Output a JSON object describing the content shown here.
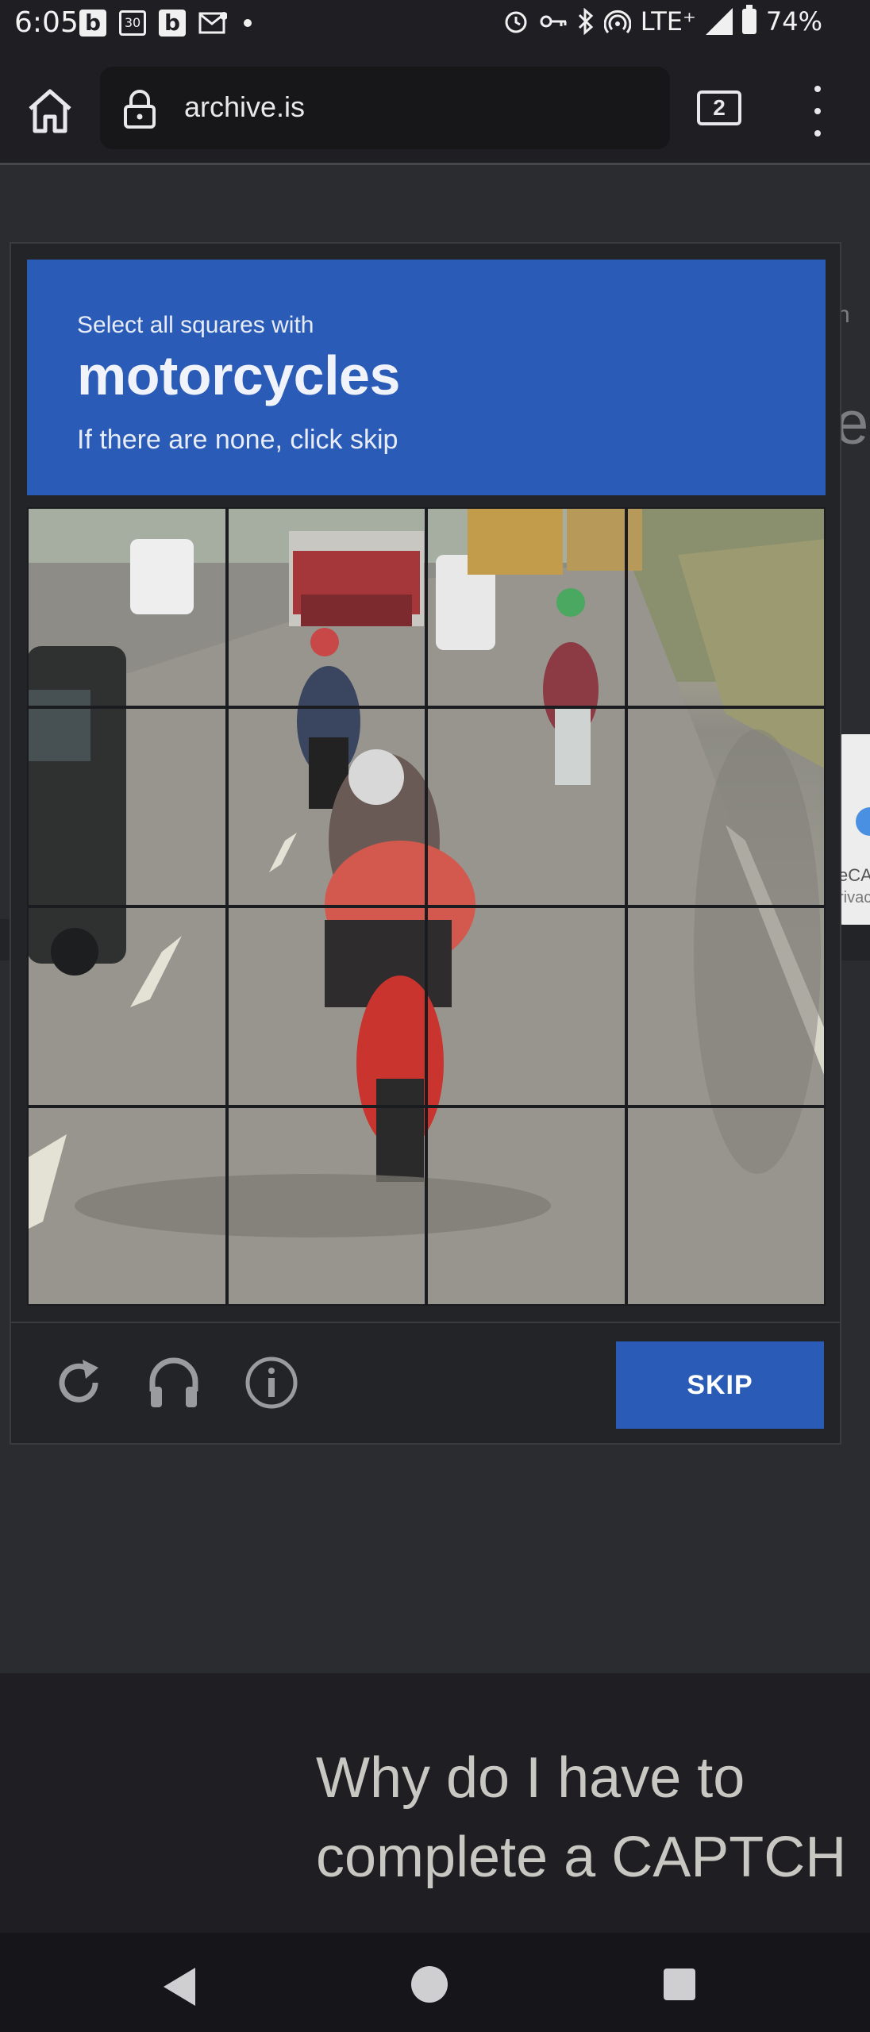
{
  "status_bar": {
    "time": "6:05",
    "left_icons": [
      "b",
      "30",
      "b"
    ],
    "network": "LTE⁺",
    "battery": "74%"
  },
  "toolbar": {
    "url": "archive.is",
    "tab_count": "2"
  },
  "captcha": {
    "instruction": "Select all squares with",
    "keyword": "motorcycles",
    "hint": "If there are none, click skip",
    "skip_label": "SKIP",
    "grid_size": 4
  },
  "help": {
    "title_line1": "Why do I have to",
    "title_line2": "complete a CAPTCH"
  },
  "behind": {
    "card_text_1": "eCA",
    "card_text_2": "rivac"
  },
  "colors": {
    "accent_blue": "#2a5bb6",
    "page_bg": "#2b2c30",
    "toolbar_bg": "#1f1f23"
  }
}
